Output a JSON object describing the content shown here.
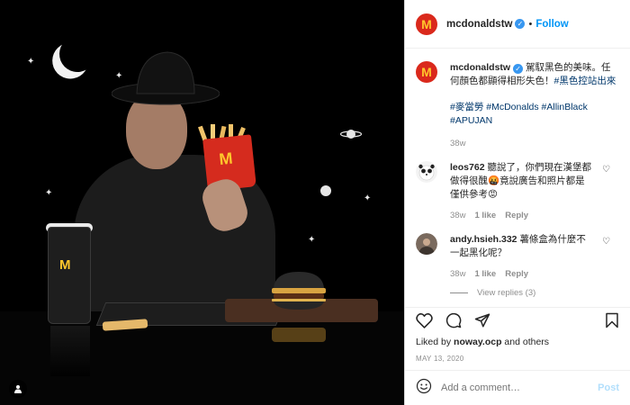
{
  "header": {
    "username": "mcdonaldstw",
    "verified_icon": "verified-badge-icon",
    "separator": "•",
    "follow_label": "Follow",
    "avatar_letter": "M"
  },
  "caption": {
    "username": "mcdonaldstw",
    "text": "駕馭黑色的美味。任何顏色都顯得相形失色！",
    "inline_tag": "#黑色控站出來",
    "hashtags": "#麥當勞 #McDonalds #AllinBlack #APUJAN",
    "age": "38w"
  },
  "comments": [
    {
      "username": "leos762",
      "text": "聽說了，你們現在漢堡都做得很醜🤬竟說廣告和照片都是僅供參考😡",
      "age": "38w",
      "likes": "1 like",
      "reply": "Reply"
    },
    {
      "username": "andy.hsieh.332",
      "text": "薯條盒為什麼不一起黑化呢？",
      "age": "38w",
      "likes": "1 like",
      "reply": "Reply",
      "view_replies": "View replies (3)"
    }
  ],
  "actions": {
    "liked_prefix": "Liked by ",
    "liked_user": "noway.ocp",
    "liked_suffix": " and others",
    "date": "MAY 13, 2020"
  },
  "add_comment": {
    "placeholder": "Add a comment…",
    "post_label": "Post"
  },
  "media": {
    "brand_letter": "M"
  },
  "colors": {
    "brand_red": "#da291c",
    "brand_yellow": "#ffc72c",
    "link_blue": "#0095f6",
    "hashtag": "#00376b"
  }
}
